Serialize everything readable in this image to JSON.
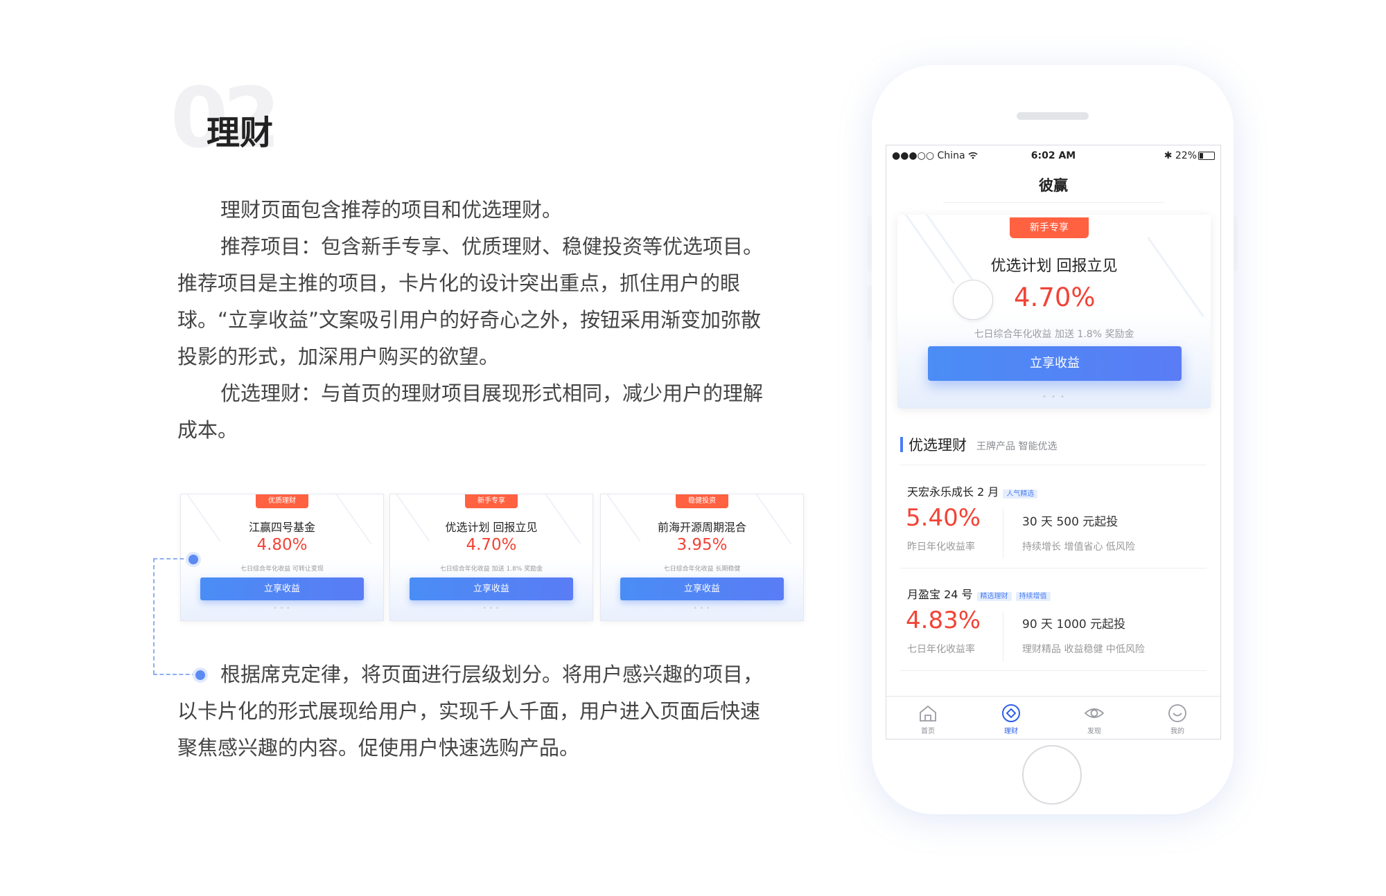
{
  "section": {
    "number": "02",
    "title": "理财"
  },
  "intro": {
    "p1": "理财页面包含推荐的项目和优选理财。",
    "p2_line1": "推荐项目：包含新手专享、优质理财、稳健投资等优选项目。",
    "p2_line2": "推荐项目是主推的项目，卡片化的设计突出重点，抓住用户的眼",
    "p2_line3": "球。“立享收益”文案吸引用户的好奇心之外，按钮采用渐变加弥散",
    "p2_line4": "投影的形式，加深用户购买的欲望。",
    "p3_line1": "优选理财：与首页的理财项目展现形式相同，减少用户的理解",
    "p3_line2": "成本。"
  },
  "mini_cards": [
    {
      "badge": "优质理财",
      "title": "江赢四号基金",
      "rate": "4.80%",
      "desc": "七日综合年化收益 可转让变现",
      "button": "立享收益",
      "dots": "• • •"
    },
    {
      "badge": "新手专享",
      "title": "优选计划 回报立见",
      "rate": "4.70%",
      "desc": "七日综合年化收益 加送 1.8% 奖励金",
      "button": "立享收益",
      "dots": "• • •"
    },
    {
      "badge": "稳健投资",
      "title": "前海开源周期混合",
      "rate": "3.95%",
      "desc": "七日综合年化收益 长期稳健",
      "button": "立享收益",
      "dots": "• • •"
    }
  ],
  "bottom_text": {
    "line1": "根据席克定律，将页面进行层级划分。将用户感兴趣的项目，",
    "line2": "以卡片化的形式展现给用户，实现千人千面，用户进入页面后快速",
    "line3": "聚焦感兴趣的内容。促使用户快速选购产品。"
  },
  "phone": {
    "status": {
      "carrier": "●●●○○ China",
      "time": "6:02 AM",
      "battery": "22%"
    },
    "app_title": "彼赢",
    "hero": {
      "badge": "新手专享",
      "title": "优选计划 回报立见",
      "rate": "4.70%",
      "desc": "七日综合年化收益 加送 1.8% 奖励金",
      "button": "立享收益",
      "dots": "• • •"
    },
    "selected": {
      "title": "优选理财",
      "subtitle": "王牌产品 智能优选"
    },
    "products": [
      {
        "name": "天宏永乐成长 2 月",
        "tags": [
          "人气精选"
        ],
        "rate": "5.40%",
        "rate_label": "昨日年化收益率",
        "term": "30 天   500 元起投",
        "desc": "持续增长 增值省心 低风险"
      },
      {
        "name": "月盈宝 24 号",
        "tags": [
          "精选理财",
          "持续增值"
        ],
        "rate": "4.83%",
        "rate_label": "七日年化收益率",
        "term": "90 天   1000 元起投",
        "desc": "理财精品 收益稳健 中低风险"
      }
    ],
    "tabs": [
      {
        "label": "首页",
        "icon": "home-icon",
        "active": false
      },
      {
        "label": "理财",
        "icon": "finance-icon",
        "active": true
      },
      {
        "label": "发现",
        "icon": "eye-icon",
        "active": false
      },
      {
        "label": "我的",
        "icon": "profile-icon",
        "active": false
      }
    ],
    "colors": {
      "accent": "#4a7df5",
      "rate_red": "#f14336",
      "badge_orange": "#ff6141"
    }
  }
}
